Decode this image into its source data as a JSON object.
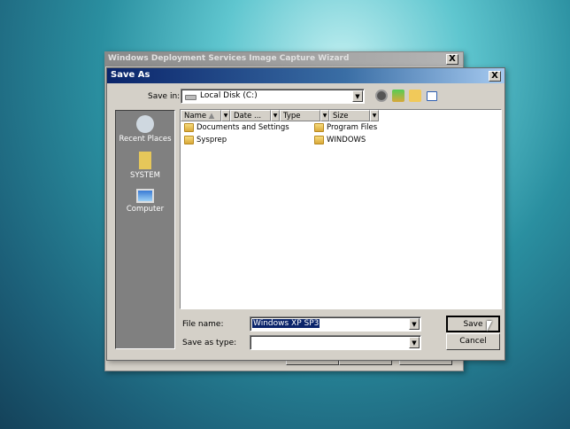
{
  "wizard": {
    "title": "Windows Deployment Services Image Capture Wizard"
  },
  "dialog": {
    "title": "Save As",
    "save_in_label": "Save in:",
    "save_in_value": "Local Disk (C:)",
    "places": [
      {
        "label": "Recent Places"
      },
      {
        "label": "SYSTEM"
      },
      {
        "label": "Computer"
      }
    ],
    "columns": [
      "Name",
      "Date ...",
      "Type",
      "Size"
    ],
    "files": [
      "Documents and Settings",
      "Sysprep",
      "Program Files",
      "WINDOWS"
    ],
    "file_name_label": "File name:",
    "file_name_value": "Windows XP SP3",
    "save_as_type_label": "Save as type:",
    "save_as_type_value": "",
    "save_button": "Save",
    "cancel_button": "Cancel",
    "close_symbol": "X",
    "dropdown_symbol": "▼"
  }
}
